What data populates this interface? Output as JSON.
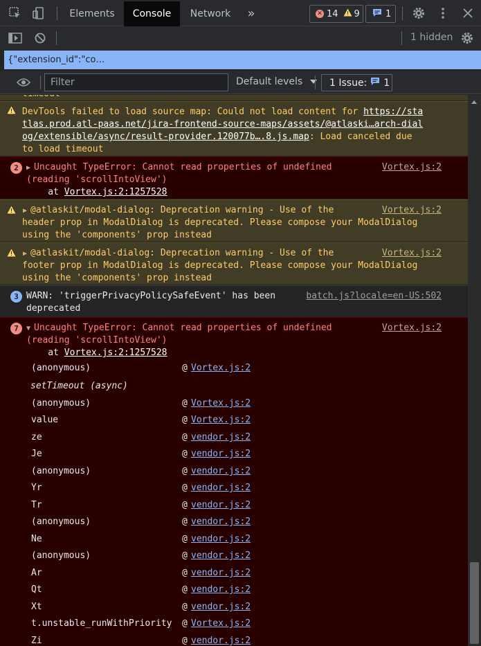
{
  "tabs": {
    "items": [
      {
        "label": "Elements",
        "active": false
      },
      {
        "label": "Console",
        "active": true
      },
      {
        "label": "Network",
        "active": false
      }
    ],
    "more": "»",
    "errors_count": "14",
    "warnings_count": "9",
    "messages_count": "1"
  },
  "toolbar": {
    "hidden_label": "1 hidden"
  },
  "context": {
    "value": "{\"extension_id\":\"co…"
  },
  "filterbar": {
    "filter_placeholder": "Filter",
    "levels_label": "Default levels",
    "issues_label": "1 Issue:",
    "issues_count": "1"
  },
  "console": {
    "partial_top": "timeout",
    "messages": [
      {
        "level": "warning",
        "lines": [
          "DevTools failed to load source map: Could not load content for ",
          "tlas.prod.atl-paas.net/jira-frontend-source-maps/assets/@atlaski…arch-dial",
          "og/extensible/async/result-provider.120077b….8.js.map",
          "to load timeout"
        ],
        "link_start": "https://sta",
        "tail": ": Load canceled due"
      },
      {
        "level": "error",
        "count": "2",
        "lines": [
          "Uncaught TypeError: Cannot read properties of undefined",
          "(reading 'scrollIntoView')",
          "    at "
        ],
        "at_link": "Vortex.js:2:1257528",
        "source": "Vortex.js:2"
      },
      {
        "level": "warning",
        "lines": [
          "@atlaskit/modal-dialog: Deprecation warning - Use of the",
          "header prop in ModalDialog is deprecated. Please compose your ModalDialog",
          "using the 'components' prop instead"
        ],
        "source": "Vortex.js:2"
      },
      {
        "level": "warning",
        "lines": [
          "@atlaskit/modal-dialog: Deprecation warning - Use of the",
          "footer prop in ModalDialog is deprecated. Please compose your ModalDialog",
          "using the 'components' prop instead"
        ],
        "source": "Vortex.js:2"
      },
      {
        "level": "info",
        "count": "3",
        "lines": [
          "WARN: 'triggerPrivacyPolicySafeEvent' has been",
          "deprecated"
        ],
        "source": "batch.js?locale=en-US:502"
      },
      {
        "level": "error",
        "count": "7",
        "lines": [
          "Uncaught TypeError: Cannot read properties of undefined",
          "(reading 'scrollIntoView')",
          "    at "
        ],
        "at_link": "Vortex.js:2:1257528",
        "source": "Vortex.js:2"
      }
    ],
    "stack": [
      {
        "fn": "(anonymous)",
        "file": "Vortex.js:2"
      },
      {
        "fn": "setTimeout (async)",
        "file": ""
      },
      {
        "fn": "(anonymous)",
        "file": "Vortex.js:2"
      },
      {
        "fn": "value",
        "file": "Vortex.js:2"
      },
      {
        "fn": "ze",
        "file": "vendor.js:2"
      },
      {
        "fn": "Je",
        "file": "vendor.js:2"
      },
      {
        "fn": "(anonymous)",
        "file": "vendor.js:2"
      },
      {
        "fn": "Yr",
        "file": "vendor.js:2"
      },
      {
        "fn": "Tr",
        "file": "vendor.js:2"
      },
      {
        "fn": "(anonymous)",
        "file": "vendor.js:2"
      },
      {
        "fn": "Ne",
        "file": "vendor.js:2"
      },
      {
        "fn": "(anonymous)",
        "file": "vendor.js:2"
      },
      {
        "fn": "Ar",
        "file": "vendor.js:2"
      },
      {
        "fn": "Qt",
        "file": "vendor.js:2"
      },
      {
        "fn": "Xt",
        "file": "vendor.js:2"
      },
      {
        "fn": "t.unstable_runWithPriority",
        "file": "Vortex.js:2"
      },
      {
        "fn": "Zi",
        "file": "vendor.js:2"
      }
    ],
    "at_symbol": "@"
  },
  "colors": {
    "accent": "#8ab4f8",
    "error_bg": "#290000",
    "error_text": "#ff8080",
    "warning_bg": "#413c26",
    "warning_text": "#ffcb6b"
  }
}
